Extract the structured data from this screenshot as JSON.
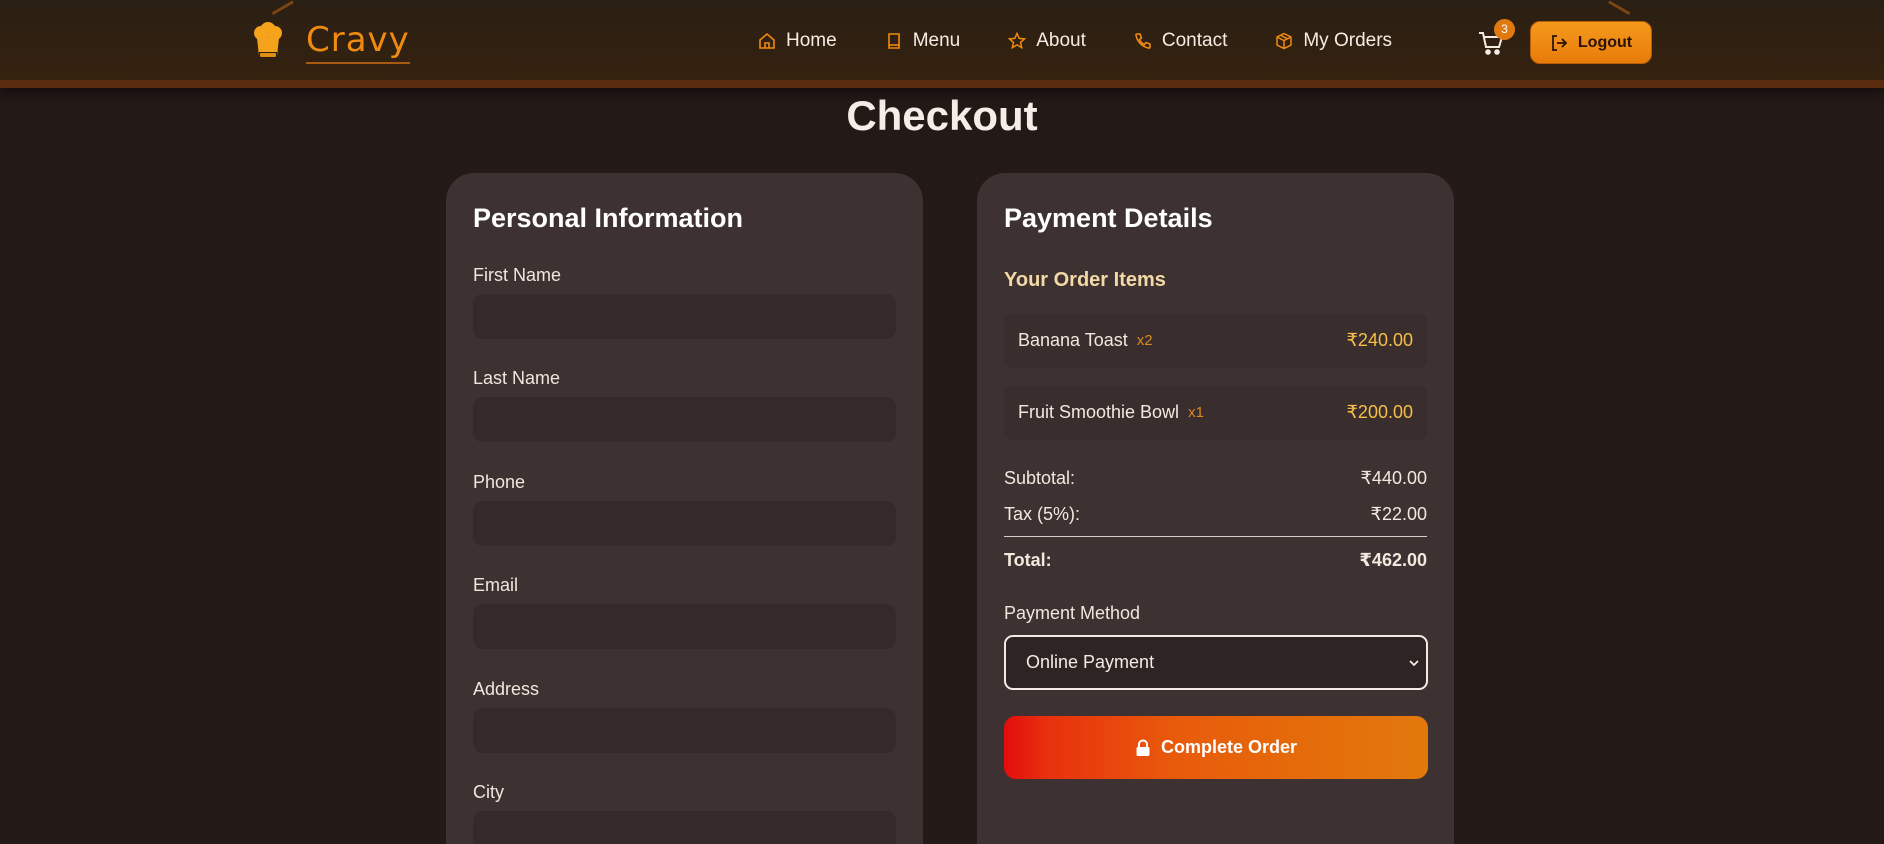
{
  "header": {
    "brand": "Cravy",
    "nav": [
      {
        "label": "Home",
        "icon": "home-icon"
      },
      {
        "label": "Menu",
        "icon": "book-icon"
      },
      {
        "label": "About",
        "icon": "star-icon"
      },
      {
        "label": "Contact",
        "icon": "phone-icon"
      },
      {
        "label": "My Orders",
        "icon": "package-icon"
      }
    ],
    "cart_count": "3",
    "logout_label": "Logout"
  },
  "page": {
    "title": "Checkout"
  },
  "personal": {
    "title": "Personal Information",
    "fields": [
      {
        "label": "First Name",
        "value": ""
      },
      {
        "label": "Last Name",
        "value": ""
      },
      {
        "label": "Phone",
        "value": ""
      },
      {
        "label": "Email",
        "value": ""
      },
      {
        "label": "Address",
        "value": ""
      },
      {
        "label": "City",
        "value": ""
      }
    ]
  },
  "payment": {
    "title": "Payment Details",
    "order_heading": "Your Order Items",
    "items": [
      {
        "name": "Banana Toast",
        "qty": "x2",
        "price": "₹240.00"
      },
      {
        "name": "Fruit Smoothie Bowl",
        "qty": "x1",
        "price": "₹200.00"
      }
    ],
    "subtotal_label": "Subtotal:",
    "subtotal": "₹440.00",
    "tax_label": "Tax (5%):",
    "tax": "₹22.00",
    "total_label": "Total:",
    "total": "₹462.00",
    "method_label": "Payment Method",
    "method_value": "Online Payment",
    "complete_label": "Complete Order"
  },
  "colors": {
    "accent": "#f08a10",
    "card": "#3e3131",
    "background": "#231917",
    "price": "#f6c046"
  }
}
